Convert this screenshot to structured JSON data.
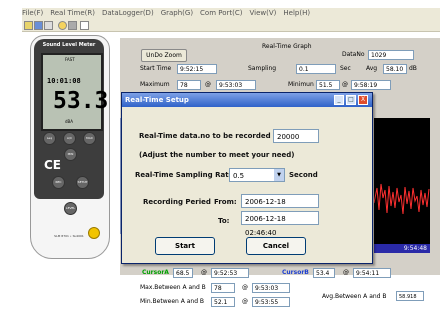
{
  "menu": [
    "File(F)",
    "Real Time(R)",
    "DataLogger(D)",
    "Graph(G)",
    "Com Port(C)",
    "View(V)",
    "Help(H)"
  ],
  "device": {
    "title": "Sound Level Meter",
    "lcd_mode": "FAST",
    "lcd_time": "10:01:08",
    "lcd_value": "53.3",
    "lcd_unit": "dBA",
    "ce": "CE",
    "buttons": [
      "Leq",
      "A/C",
      "MAX",
      "MIN",
      "REC",
      "SETUP",
      "LEVEL"
    ],
    "model": "SLM 8701 • SL4001"
  },
  "panel": {
    "undo_zoom": "UnDo Zoom",
    "graph_title": "Real-Time Graph",
    "datano_label": "DataNo",
    "datano_value": "1029",
    "start_time_label": "Start Time",
    "start_time_value": "9:52:15",
    "sampling_label": "Sampling",
    "sampling_value": "0.1",
    "sec_label": "Sec",
    "avg_label": "Avg",
    "avg_value": "58.10",
    "db_unit": "dB",
    "max_label": "Maximum",
    "max_value": "78",
    "max_at": "@",
    "max_time": "9:53:03",
    "min_label": "Minimun",
    "min_value": "51.5",
    "min_at": "@",
    "min_time": "9:58:19",
    "graph_timestamp": "9:54:48"
  },
  "cursors": {
    "a_label": "CursorA",
    "a_value": "68.5",
    "a_at": "@",
    "a_time": "9:52:53",
    "b_label": "CursorB",
    "b_value": "53.4",
    "b_at": "@",
    "b_time": "9:54:11",
    "max_label": "Max.Between A and B",
    "max_value": "78",
    "max_at": "@",
    "max_time": "9:53:03",
    "min_label": "Min.Between A and B",
    "min_value": "52.1",
    "min_at": "@",
    "min_time": "9:53:55",
    "avg_label": "Avg.Between A and B",
    "avg_value": "58.918"
  },
  "dialog": {
    "title": "Real-Time Setup",
    "records_label": "Real-Time data.no to be recorded",
    "records_value": "20000",
    "adjust_note": "(Adjust the number to meet your need)",
    "rate_label": "Real-Time Sampling Rate",
    "rate_value": "0.5",
    "rate_unit": "Second",
    "period_label": "Recording Peried",
    "from_label": "From:",
    "from_value": "2006-12-18 00:00:00",
    "to_label": "To:",
    "to_value": "2006-12-18 02:46:40",
    "start_label": "Start",
    "cancel_label": "Cancel",
    "minimize": "_",
    "maximize": "□",
    "close": "X"
  },
  "colors": {
    "title_bar": "#2f62c9",
    "graph_bg": "#000000",
    "trace": "#ff3030",
    "cursor_a": "#00a000",
    "cursor_b": "#1e3fd0"
  }
}
